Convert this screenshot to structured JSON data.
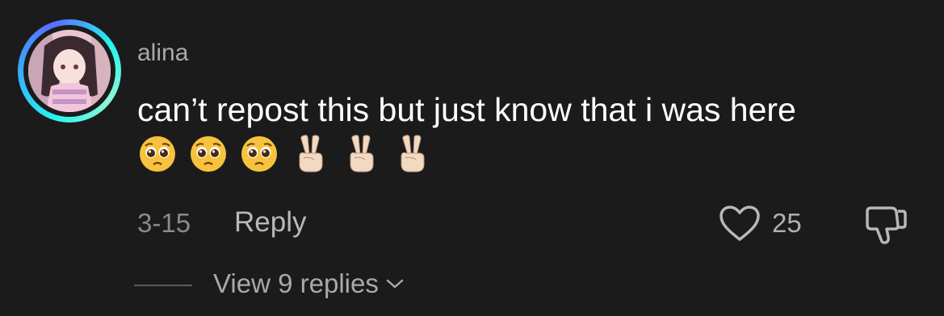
{
  "comment": {
    "username": "alina",
    "text": "can’t repost this but just know that i was here",
    "emojis": [
      "pleading-face",
      "pleading-face",
      "pleading-face",
      "victory-hand",
      "victory-hand",
      "victory-hand"
    ],
    "date": "3-15",
    "reply_label": "Reply",
    "like_count": "25",
    "view_replies_label": "View 9 replies"
  },
  "icons": {
    "avatar_ring": "gradient-ring",
    "like": "heart-outline-icon",
    "dislike": "thumbs-down-icon",
    "expand": "chevron-down-icon"
  },
  "colors": {
    "background": "#1b1b1b",
    "ring_accent": "#25f4ee",
    "text_primary": "#ffffff",
    "text_secondary": "#a9a9a9"
  }
}
